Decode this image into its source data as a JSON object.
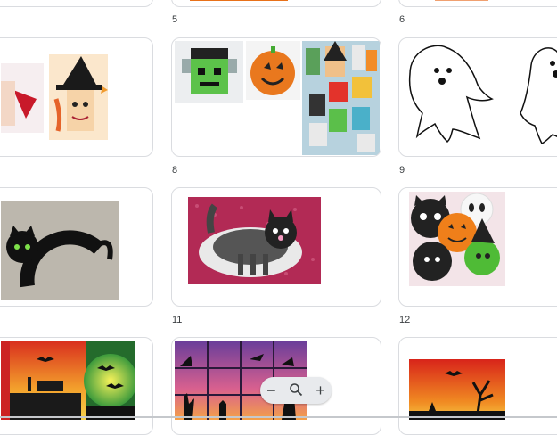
{
  "grid": {
    "page_numbers": [
      "5",
      "6",
      "8",
      "9",
      "11",
      "12"
    ]
  },
  "thumbnails": [
    {
      "name": "vampire-witch-rolls",
      "icon": "craft-image"
    },
    {
      "name": "frankenstein-pumpkin-rolls",
      "icon": "craft-image"
    },
    {
      "name": "ghost-outlines",
      "icon": "ghost-icon"
    },
    {
      "name": "paper-plate-cat",
      "icon": "cat-icon"
    },
    {
      "name": "black-cat-plate",
      "icon": "cat-icon"
    },
    {
      "name": "halloween-circles",
      "icon": "pumpkin-icon"
    },
    {
      "name": "sunset-silhouettes",
      "icon": "bat-icon"
    },
    {
      "name": "purple-grid-silhouettes",
      "icon": "witch-icon"
    },
    {
      "name": "red-sunset-tree",
      "icon": "tree-icon"
    }
  ],
  "colors": {
    "card_border": "#dadce0",
    "zoom_bg": "#e8eaed"
  },
  "zoom": {
    "minus": "−",
    "plus": "+",
    "zoom_icon": "zoom-icon"
  }
}
